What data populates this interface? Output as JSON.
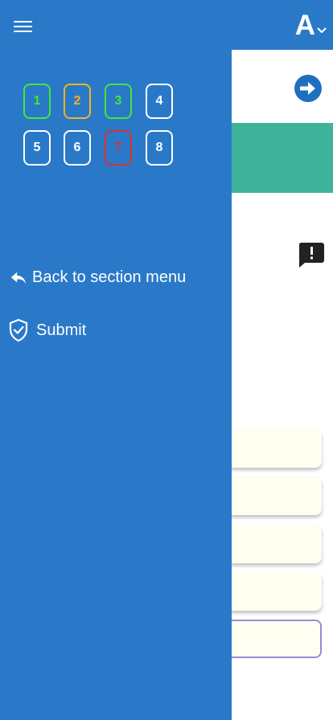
{
  "header": {
    "font_size_label": "A"
  },
  "drawer": {
    "questions": [
      {
        "number": "1",
        "color": "#45e63a"
      },
      {
        "number": "2",
        "color": "#f3b41b"
      },
      {
        "number": "3",
        "color": "#45e63a"
      },
      {
        "number": "4",
        "color": "#ffffff"
      },
      {
        "number": "5",
        "color": "#ffffff"
      },
      {
        "number": "6",
        "color": "#ffffff"
      },
      {
        "number": "7",
        "color": "#d8312d"
      },
      {
        "number": "8",
        "color": "#ffffff"
      }
    ],
    "back_label": "Back to section menu",
    "submit_label": "Submit"
  },
  "colors": {
    "primary": "#2a79c9",
    "band": "#3fb39a",
    "option_bg": "#fefff1",
    "selected_border": "#9c89d6"
  }
}
